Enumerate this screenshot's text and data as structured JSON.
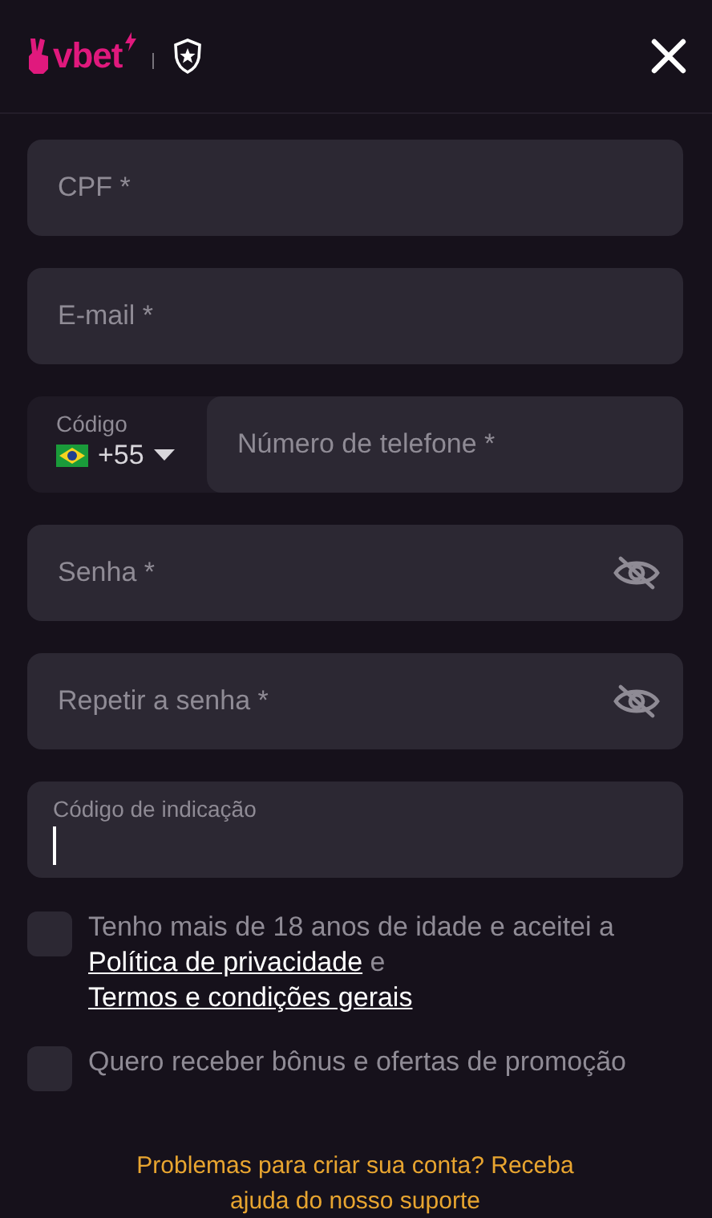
{
  "header": {
    "logo_text": "vbet"
  },
  "fields": [
    {
      "kind": "text",
      "placeholder": "CPF *"
    },
    {
      "kind": "text",
      "placeholder": "E-mail *"
    },
    {
      "kind": "phone",
      "code_label": "Código",
      "code_value": "+55",
      "placeholder": "Número de telefone *"
    },
    {
      "kind": "password",
      "placeholder": "Senha *"
    },
    {
      "kind": "password",
      "placeholder": "Repetir a senha *"
    },
    {
      "kind": "floating",
      "label": "Código de indicação",
      "focused": true
    }
  ],
  "checkboxes": [
    {
      "checked": false,
      "parts": [
        {
          "kind": "text",
          "text": "Tenho mais de 18 anos de idade e aceitei a "
        },
        {
          "kind": "link",
          "text": "Política de privacidade"
        },
        {
          "kind": "text",
          "text": " e "
        },
        {
          "kind": "link",
          "text": "Termos e condições gerais"
        }
      ]
    },
    {
      "checked": false,
      "parts": [
        {
          "kind": "text",
          "text": "Quero receber bônus e ofertas de promoção"
        }
      ]
    }
  ],
  "help_text": "Problemas para criar sua conta? Receba ajuda do nosso suporte"
}
